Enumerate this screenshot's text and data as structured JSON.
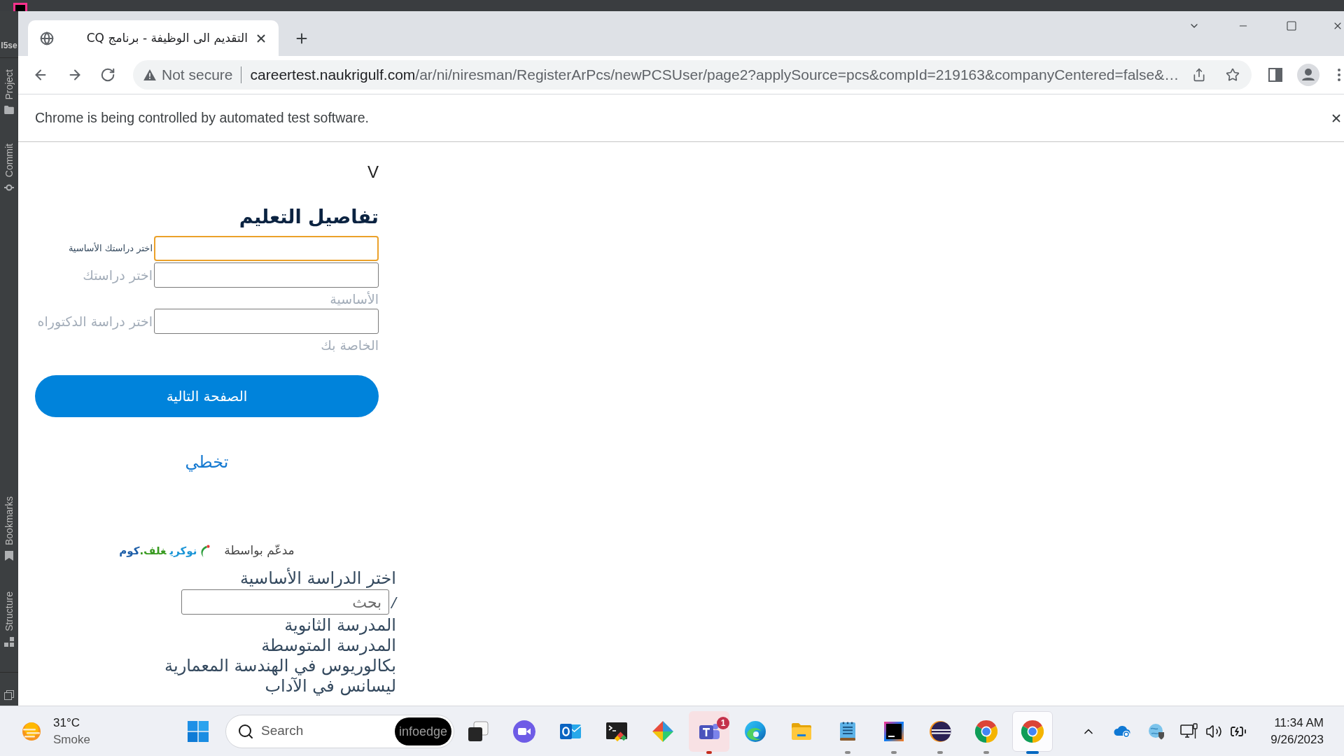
{
  "ide": {
    "project_label": "l5se",
    "tool_tabs_top": [
      {
        "kind": "project",
        "label": "Project"
      },
      {
        "kind": "commit",
        "label": "Commit"
      }
    ],
    "tool_tabs_bottom": [
      {
        "kind": "bookmarks",
        "label": "Bookmarks"
      },
      {
        "kind": "structure",
        "label": "Structure"
      }
    ]
  },
  "browser": {
    "tabs": [
      {
        "title": "التقديم الى الوظيفة - برنامج CQ",
        "selected": true
      }
    ],
    "address_bar": {
      "security": "Not secure",
      "url_host": "careertest.naukrigulf.com",
      "url_path": "/ar/ni/niresman/RegisterArPcs/newPCSUser/page2?applySource=pcs&compId=219163&companyCentered=false&…"
    },
    "infobar": {
      "message": "Chrome is being controlled by automated test software."
    }
  },
  "page": {
    "step_marker": "V",
    "heading": "تفاصيل التعليم",
    "fields": [
      {
        "label_lines": [
          "اختر دراستك الأساسية"
        ],
        "floated": true,
        "focused": true
      },
      {
        "label_lines": [
          "اختر دراستك",
          "الأساسية"
        ],
        "floated": false,
        "focused": false
      },
      {
        "label_lines": [
          "اختر دراسة الدكتوراه",
          "الخاصة بك"
        ],
        "floated": false,
        "focused": false
      }
    ],
    "next_button": "الصفحة التالية",
    "skip_link": "تخطي",
    "powered_by": {
      "label": "مدعّم بواسطة",
      "logo_parts": [
        {
          "text": "نوكري",
          "color": "#1b95d6"
        },
        {
          "text": "غلف.",
          "color": "#3a9b22"
        },
        {
          "text": "كوم",
          "color": "#1d5ea8"
        }
      ]
    },
    "dropdown": {
      "title": "اختر الدراسة الأساسية",
      "search_prefix": "/",
      "search_placeholder": "بحث",
      "options": [
        "المدرسة الثانوية",
        "المدرسة المتوسطة",
        "بكالوريوس في الهندسة المعمارية",
        "ليسانس في الآداب"
      ]
    }
  },
  "taskbar": {
    "weather": {
      "temperature": "31°C",
      "condition": "Smoke"
    },
    "search": {
      "label": "Search",
      "badge": "infoedge"
    },
    "apps": [
      {
        "kind": "taskview",
        "running": false,
        "selected": false,
        "attention": false
      },
      {
        "kind": "meet",
        "running": false,
        "selected": false,
        "attention": false
      },
      {
        "kind": "outlook",
        "running": false,
        "selected": false,
        "attention": false
      },
      {
        "kind": "terminal",
        "running": false,
        "selected": false,
        "attention": false
      },
      {
        "kind": "git",
        "running": false,
        "selected": false,
        "attention": false
      },
      {
        "kind": "teams",
        "running": true,
        "selected": false,
        "attention": true,
        "badge": "1"
      },
      {
        "kind": "edge",
        "running": false,
        "selected": false,
        "attention": false
      },
      {
        "kind": "explorer",
        "running": false,
        "selected": false,
        "attention": false
      },
      {
        "kind": "notepad",
        "running": true,
        "selected": false,
        "attention": false
      },
      {
        "kind": "intellij",
        "running": true,
        "selected": false,
        "attention": false
      },
      {
        "kind": "eclipse",
        "running": true,
        "selected": false,
        "attention": false
      },
      {
        "kind": "chrome",
        "running": true,
        "selected": false,
        "attention": false
      },
      {
        "kind": "chrome",
        "running": true,
        "selected": true,
        "attention": false
      }
    ],
    "clock": {
      "time": "11:34 AM",
      "date": "9/26/2023"
    }
  }
}
